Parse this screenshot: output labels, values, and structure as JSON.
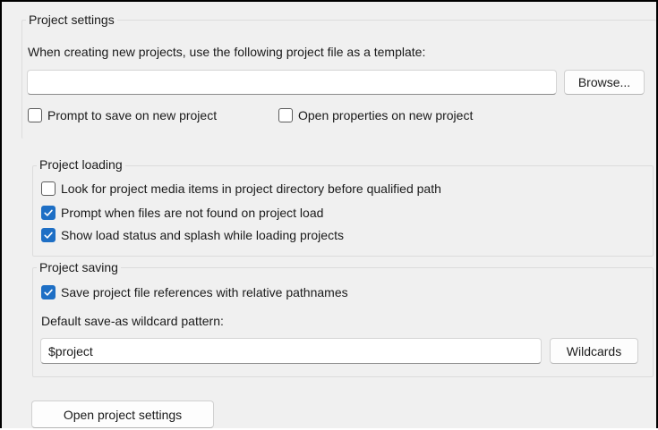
{
  "project_settings": {
    "title": "Project settings",
    "template_label": "When creating new projects, use the following project file as a template:",
    "template_value": "",
    "browse_label": "Browse...",
    "options": [
      {
        "label": "Prompt to save on new project",
        "checked": false
      },
      {
        "label": "Open properties on new project",
        "checked": false
      }
    ]
  },
  "project_loading": {
    "title": "Project loading",
    "options": [
      {
        "label": "Look for project media items in project directory before qualified path",
        "checked": false
      },
      {
        "label": "Prompt when files are not found on project load",
        "checked": true
      },
      {
        "label": "Show load status and splash while loading projects",
        "checked": true
      }
    ]
  },
  "project_saving": {
    "title": "Project saving",
    "options": [
      {
        "label": "Save project file references with relative pathnames",
        "checked": true
      }
    ],
    "wildcard_label": "Default save-as wildcard pattern:",
    "wildcard_value": "$project",
    "wildcards_button": "Wildcards"
  },
  "footer": {
    "open_settings_button": "Open project settings"
  },
  "colors": {
    "accent": "#1e6fc5",
    "panel_background": "#f0f0f0"
  }
}
